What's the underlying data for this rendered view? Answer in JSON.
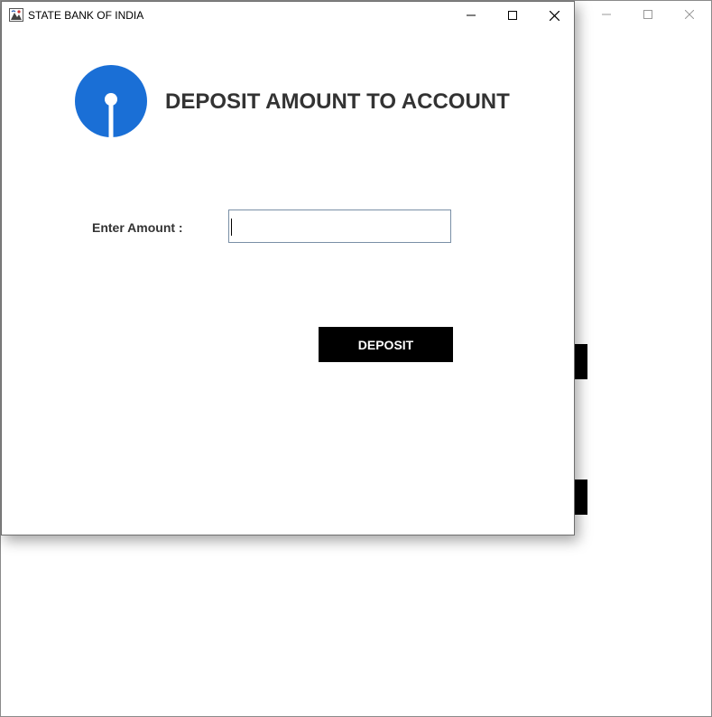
{
  "background_window": {
    "controls": [
      "minimize",
      "maximize",
      "close"
    ]
  },
  "window": {
    "title": "STATE BANK OF INDIA",
    "controls": [
      "minimize",
      "maximize",
      "close"
    ]
  },
  "form": {
    "heading": "DEPOSIT AMOUNT TO ACCOUNT",
    "amount_label": "Enter Amount :",
    "amount_value": "",
    "deposit_label": "DEPOSIT"
  },
  "colors": {
    "logo_blue": "#1a6fd6",
    "button_bg": "#000000",
    "button_text": "#ffffff",
    "heading_text": "#333333"
  }
}
